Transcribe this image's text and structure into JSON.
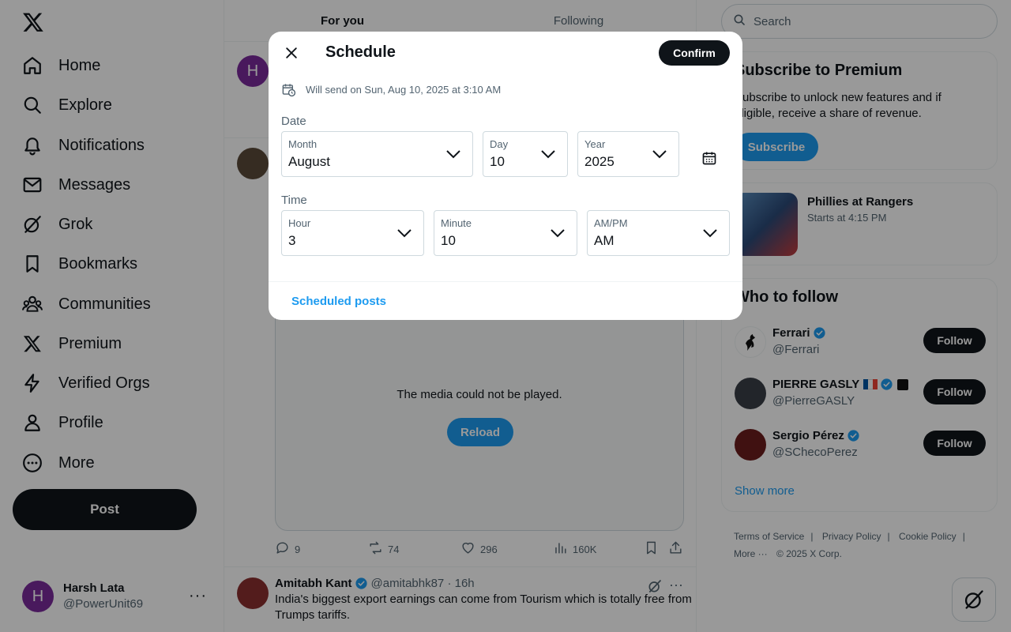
{
  "nav": {
    "items": [
      {
        "label": "Home",
        "icon": "home-icon"
      },
      {
        "label": "Explore",
        "icon": "search-icon"
      },
      {
        "label": "Notifications",
        "icon": "bell-icon"
      },
      {
        "label": "Messages",
        "icon": "envelope-icon"
      },
      {
        "label": "Grok",
        "icon": "grok-icon"
      },
      {
        "label": "Bookmarks",
        "icon": "bookmark-icon"
      },
      {
        "label": "Communities",
        "icon": "people-icon"
      },
      {
        "label": "Premium",
        "icon": "x-logo-icon"
      },
      {
        "label": "Verified Orgs",
        "icon": "lightning-icon"
      },
      {
        "label": "Profile",
        "icon": "person-icon"
      },
      {
        "label": "More",
        "icon": "more-circle-icon"
      }
    ],
    "post_label": "Post"
  },
  "account": {
    "initial": "H",
    "name": "Harsh Lata",
    "handle": "@PowerUnit69",
    "more": "···"
  },
  "feed": {
    "tabs": [
      "For you",
      "Following"
    ],
    "media_message": "The media could not be played.",
    "reload_label": "Reload",
    "actions": {
      "replies": "9",
      "reposts": "74",
      "likes": "296",
      "views": "160K"
    },
    "tweet2": {
      "name": "Amitabh Kant",
      "handle": "@amitabhk87 · 16h",
      "text": "India's biggest export earnings can come from Tourism which is totally free from Trumps tariffs."
    },
    "avatar_initial": "H"
  },
  "right": {
    "search_placeholder": "Search",
    "premium": {
      "title": "Subscribe to Premium",
      "text": "Subscribe to unlock new features and if eligible, receive a share of revenue.",
      "button": "Subscribe"
    },
    "sport": {
      "title": "Phillies at Rangers",
      "subtitle": "Starts at 4:15 PM"
    },
    "who_to_follow": {
      "title": "Who to follow",
      "accounts": [
        {
          "name": "Ferrari",
          "handle": "@Ferrari",
          "button": "Follow"
        },
        {
          "name": "PIERRE GASLY",
          "handle": "@PierreGASLY",
          "button": "Follow"
        },
        {
          "name": "Sergio Pérez",
          "handle": "@SChecoPerez",
          "button": "Follow"
        }
      ],
      "show_more": "Show more"
    },
    "footer": {
      "links": [
        "Terms of Service",
        "|",
        "Privacy Policy",
        "|",
        "Cookie Policy",
        "|"
      ],
      "more": "More ···",
      "copyright": "© 2025 X Corp."
    }
  },
  "modal": {
    "title": "Schedule",
    "confirm_label": "Confirm",
    "info": "Will send on Sun, Aug 10, 2025 at 3:10 AM",
    "date_label": "Date",
    "time_label": "Time",
    "month": {
      "label": "Month",
      "value": "August"
    },
    "day": {
      "label": "Day",
      "value": "10"
    },
    "year": {
      "label": "Year",
      "value": "2025"
    },
    "hour": {
      "label": "Hour",
      "value": "3"
    },
    "minute": {
      "label": "Minute",
      "value": "10"
    },
    "ampm": {
      "label": "AM/PM",
      "value": "AM"
    },
    "scheduled_posts": "Scheduled posts"
  },
  "colors": {
    "accent": "#1d9bf0",
    "text": "#0f1419",
    "muted": "#536471",
    "border": "#cfd9de"
  }
}
